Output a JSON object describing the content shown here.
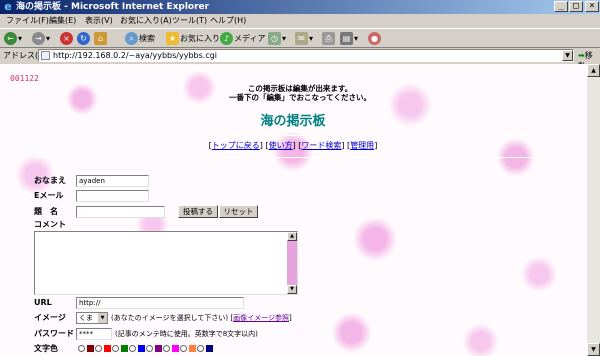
{
  "window": {
    "title": "海の掲示板 - Microsoft Internet Explorer",
    "btn_min": "_",
    "btn_max": "□",
    "btn_close": "×"
  },
  "menu": [
    "ファイル(F)",
    "編集(E)",
    "表示(V)",
    "お気に入り(A)",
    "ツール(T)",
    "ヘルプ(H)"
  ],
  "toolbar": {
    "search": "検索",
    "favorites": "お気に入り",
    "media": "メディア"
  },
  "address": {
    "label": "アドレス(D)",
    "url": "http://192.168.0.2/~aya/yybbs/yybbs.cgi",
    "go": "移動"
  },
  "page": {
    "counter": "001122",
    "notice_line1": "この掲示板は編集が出来ます。",
    "notice_line2": "一番下の「編集」でおこなってください。",
    "title": "海の掲示板",
    "nav": [
      "トップに戻る",
      "使い方",
      "ワード検索",
      "管理用"
    ]
  },
  "form": {
    "name_label": "おなまえ",
    "name_value": "ayaden",
    "email_label": "Eメール",
    "email_value": "",
    "subject_label": "題　名",
    "subject_value": "",
    "submit_label": "投稿する",
    "reset_label": "リセット",
    "comment_label": "コメント",
    "url_label": "URL",
    "url_value": "http://",
    "image_label": "イメージ",
    "image_value": "くま",
    "image_note": "(あなたのイメージを選択して下さい)",
    "image_link": "画像イメージ参照",
    "password_label": "パスワード",
    "password_value": "****",
    "password_note": "(記事のメンテ時に使用。英数字で8文字以内)",
    "color_label": "文字色",
    "colors": [
      "#800000",
      "#ff0000",
      "#008000",
      "#0000ff",
      "#800080",
      "#ff00ff",
      "#ff8040",
      "#000080"
    ]
  }
}
